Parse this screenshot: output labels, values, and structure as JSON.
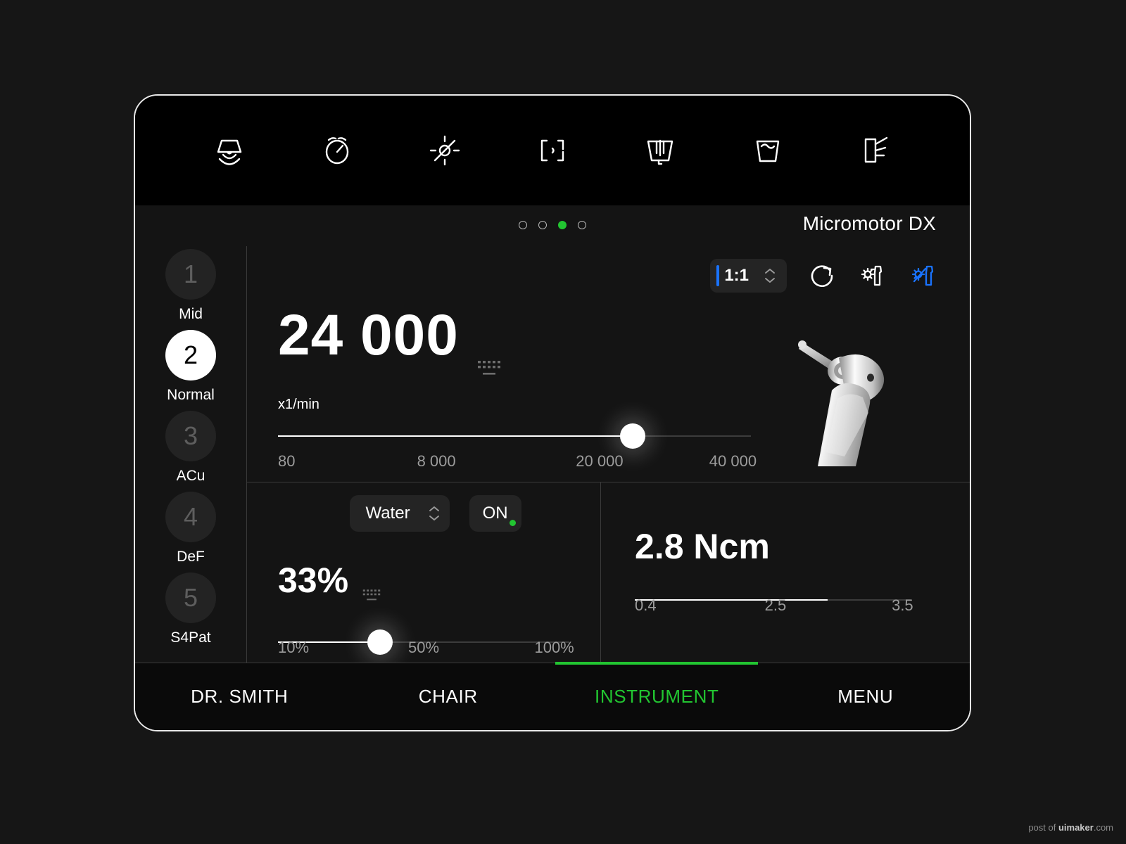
{
  "device": {
    "name": "Micromotor DX",
    "page_dots": {
      "count": 4,
      "active_index": 2,
      "active_color": "#22c531"
    }
  },
  "topbar": {
    "icons": [
      {
        "name": "operating-light-icon",
        "label": "Operating light"
      },
      {
        "name": "timer-icon",
        "label": "Timer"
      },
      {
        "name": "light-toggle-icon",
        "label": "Light on/off"
      },
      {
        "name": "chair-position-icon",
        "label": "Chair position"
      },
      {
        "name": "bowl-rinse-icon",
        "label": "Bowl rinse"
      },
      {
        "name": "cup-fill-icon",
        "label": "Cup fill"
      },
      {
        "name": "chair-recline-icon",
        "label": "Chair recline"
      }
    ]
  },
  "presets": {
    "items": [
      {
        "number": "1",
        "label": "Mid",
        "selected": false
      },
      {
        "number": "2",
        "label": "Normal",
        "selected": true
      },
      {
        "number": "3",
        "label": "ACu",
        "selected": false
      },
      {
        "number": "4",
        "label": "DeF",
        "selected": false
      },
      {
        "number": "5",
        "label": "S4Pat",
        "selected": false
      }
    ]
  },
  "speed": {
    "ratio": "1:1",
    "ratio_accent": "#1a73ff",
    "value": "24 000",
    "unit": "x1/min",
    "ticks": [
      "80",
      "8 000",
      "20 000",
      "40 000"
    ],
    "tick_positions": [
      0,
      33.5,
      68,
      100
    ],
    "fill_percent": 75,
    "thumb_percent": 75,
    "controls": [
      {
        "name": "rotation-direction-icon",
        "label": "Rotation direction",
        "active": false
      },
      {
        "name": "handpiece-spray-icon",
        "label": "Handpiece spray",
        "active": false
      },
      {
        "name": "handpiece-light-icon",
        "label": "Handpiece light",
        "active": true
      }
    ]
  },
  "coolant": {
    "medium": "Water",
    "power_label": "ON",
    "power_on": true,
    "status_color": "#22c531",
    "value": "33%",
    "ticks": [
      "10%",
      "50%",
      "100%"
    ],
    "tick_positions": [
      0,
      50,
      100
    ],
    "fill_percent": 35,
    "thumb_percent": 35
  },
  "torque": {
    "value": "2.8 Ncm",
    "ticks": [
      "0.4",
      "2.5",
      "3.5"
    ],
    "tick_positions": [
      0,
      51,
      100
    ],
    "fill_percent": 70
  },
  "bottom_nav": {
    "items": [
      {
        "label": "DR. SMITH",
        "active": false
      },
      {
        "label": "CHAIR",
        "active": false
      },
      {
        "label": "INSTRUMENT",
        "active": true
      },
      {
        "label": "MENU",
        "active": false
      }
    ],
    "active_color": "#22c531"
  },
  "watermark": {
    "prefix": "post of ",
    "brand": "uimaker",
    "suffix": ".com"
  }
}
